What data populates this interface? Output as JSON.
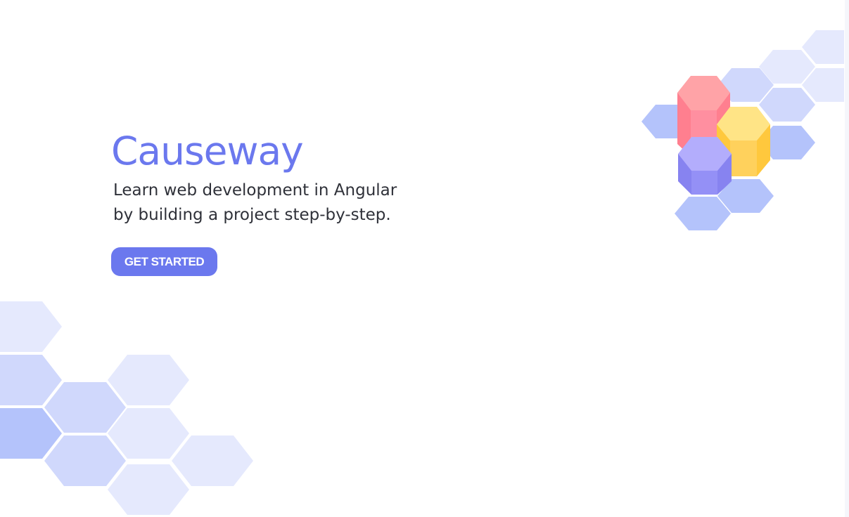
{
  "hero": {
    "title": "Causeway",
    "tagline_line1": "Learn web development in Angular",
    "tagline_line2": "by building a project step-by-step.",
    "cta_label": "GET STARTED"
  },
  "colors": {
    "brand": "#6b78ee",
    "text": "#2f3139",
    "hex_light": "#e5e9fd",
    "hex_mid": "#d0d8fc",
    "hex_dark": "#b4c3fb",
    "pink": "#ff8796",
    "yellow": "#ffd15c",
    "purple": "#9490f6"
  },
  "graphic": {
    "icon": "hexagon-blocks-illustration"
  }
}
